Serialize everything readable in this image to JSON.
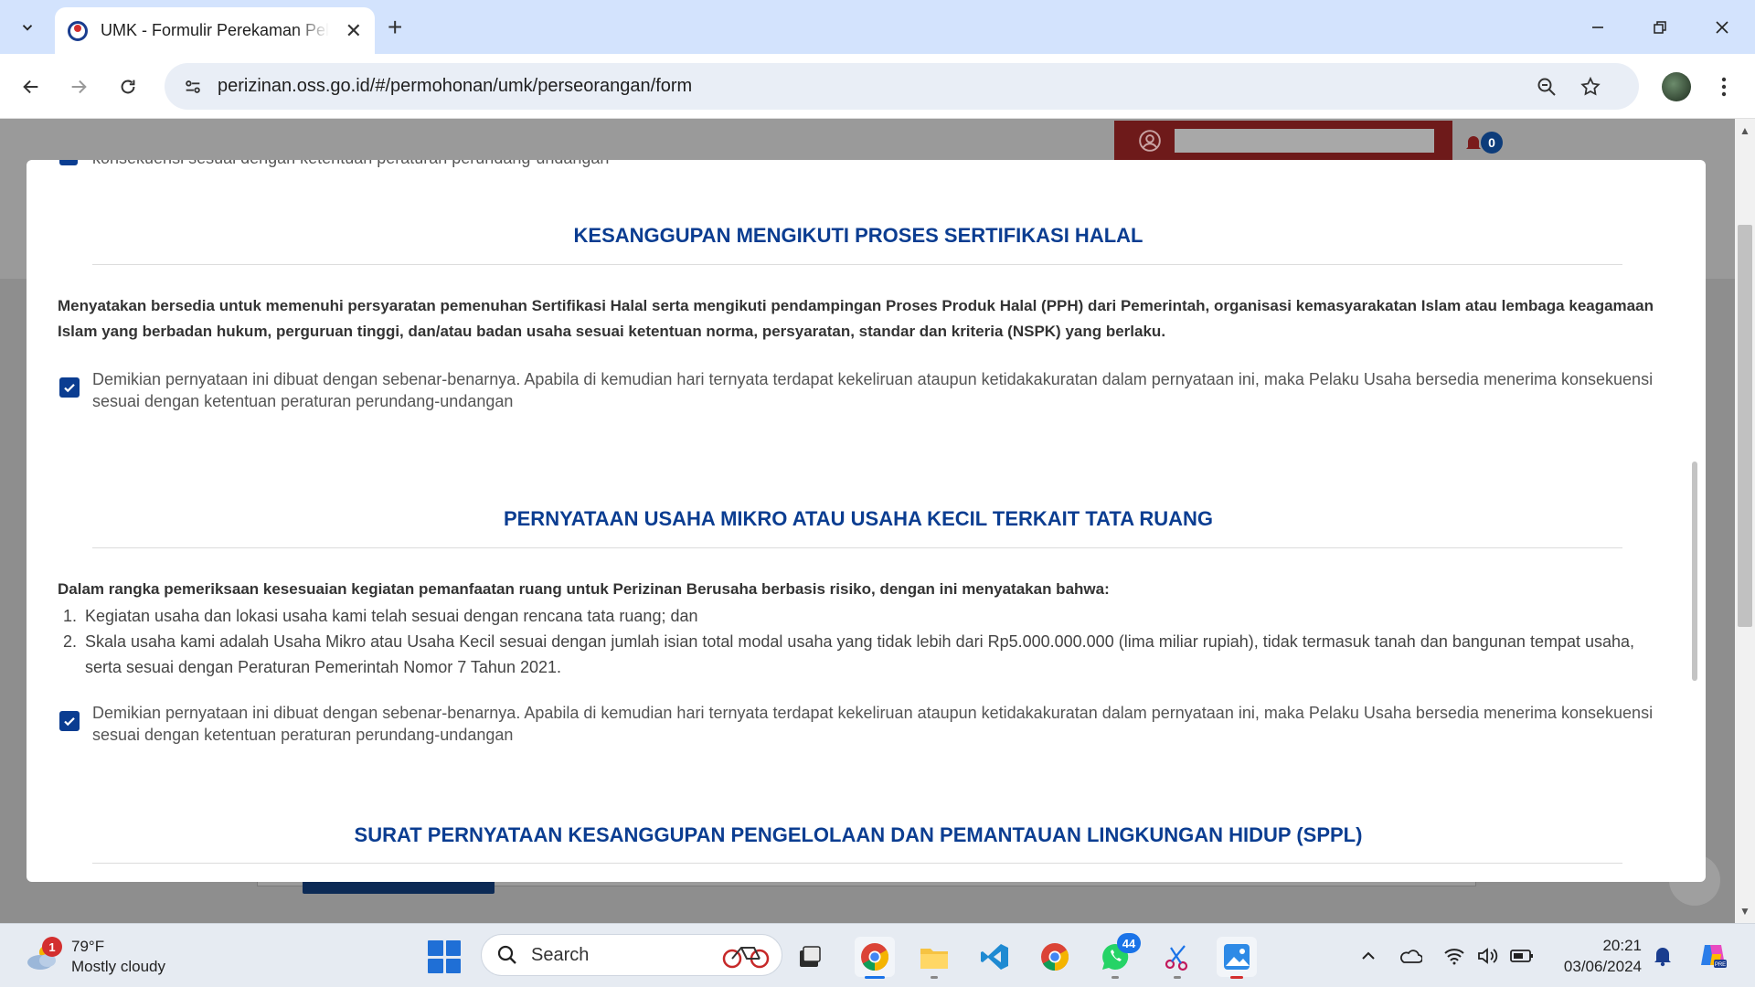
{
  "browser": {
    "tab_title": "UMK - Formulir Perekaman Pelaku Usaha",
    "url": "perizinan.oss.go.id/#/permohonan/umk/perseorangan/form"
  },
  "page_behind": {
    "notification_count": "0"
  },
  "modal": {
    "clipped_top_text": "konsekuensi sesuai dengan ketentuan peraturan perundang-undangan",
    "sections": [
      {
        "title": "KESANGGUPAN MENGIKUTI PROSES SERTIFIKASI HALAL",
        "statement": "Menyatakan bersedia untuk memenuhi persyaratan pemenuhan Sertifikasi Halal serta mengikuti pendampingan Proses Produk Halal (PPH) dari Pemerintah, organisasi kemasyarakatan Islam atau lembaga keagamaan Islam yang berbadan hukum, perguruan tinggi, dan/atau badan usaha sesuai ketentuan norma, persyaratan, standar dan kriteria (NSPK) yang berlaku.",
        "agreement": "Demikian pernyataan ini dibuat dengan sebenar-benarnya. Apabila di kemudian hari ternyata terdapat kekeliruan ataupun ketidakakuratan dalam pernyataan ini, maka Pelaku Usaha bersedia menerima konsekuensi sesuai dengan ketentuan peraturan perundang-undangan",
        "checked": true
      },
      {
        "title": "PERNYATAAN USAHA MIKRO ATAU USAHA KECIL TERKAIT TATA RUANG",
        "statement": "Dalam rangka pemeriksaan kesesuaian kegiatan pemanfaatan ruang untuk Perizinan Berusaha berbasis risiko, dengan ini menyatakan bahwa:",
        "items": [
          {
            "num": "1.",
            "text": "Kegiatan usaha dan lokasi usaha kami telah sesuai dengan rencana tata ruang; dan"
          },
          {
            "num": "2.",
            "text": "Skala usaha kami adalah Usaha Mikro atau Usaha Kecil sesuai dengan jumlah isian total modal usaha yang tidak lebih dari Rp5.000.000.000 (lima miliar rupiah), tidak termasuk tanah dan bangunan tempat usaha, serta sesuai dengan Peraturan Pemerintah Nomor 7 Tahun 2021."
          }
        ],
        "agreement": "Demikian pernyataan ini dibuat dengan sebenar-benarnya. Apabila di kemudian hari ternyata terdapat kekeliruan ataupun ketidakakuratan dalam pernyataan ini, maka Pelaku Usaha bersedia menerima konsekuensi sesuai dengan ketentuan peraturan perundang-undangan",
        "checked": true
      },
      {
        "title": "SURAT PERNYATAAN KESANGGUPAN PENGELOLAAN DAN PEMANTAUAN LINGKUNGAN HIDUP (SPPL)"
      }
    ]
  },
  "taskbar": {
    "weather_temp": "79°F",
    "weather_desc": "Mostly cloudy",
    "weather_badge": "1",
    "search_label": "Search",
    "whatsapp_badge": "44",
    "time": "20:21",
    "date": "03/06/2024"
  },
  "colors": {
    "accent_blue": "#0b3d91",
    "chrome_tabstrip": "#d3e3fd",
    "overlay_gray": "#8e8e8e",
    "user_box_red": "#6e1a1a"
  }
}
